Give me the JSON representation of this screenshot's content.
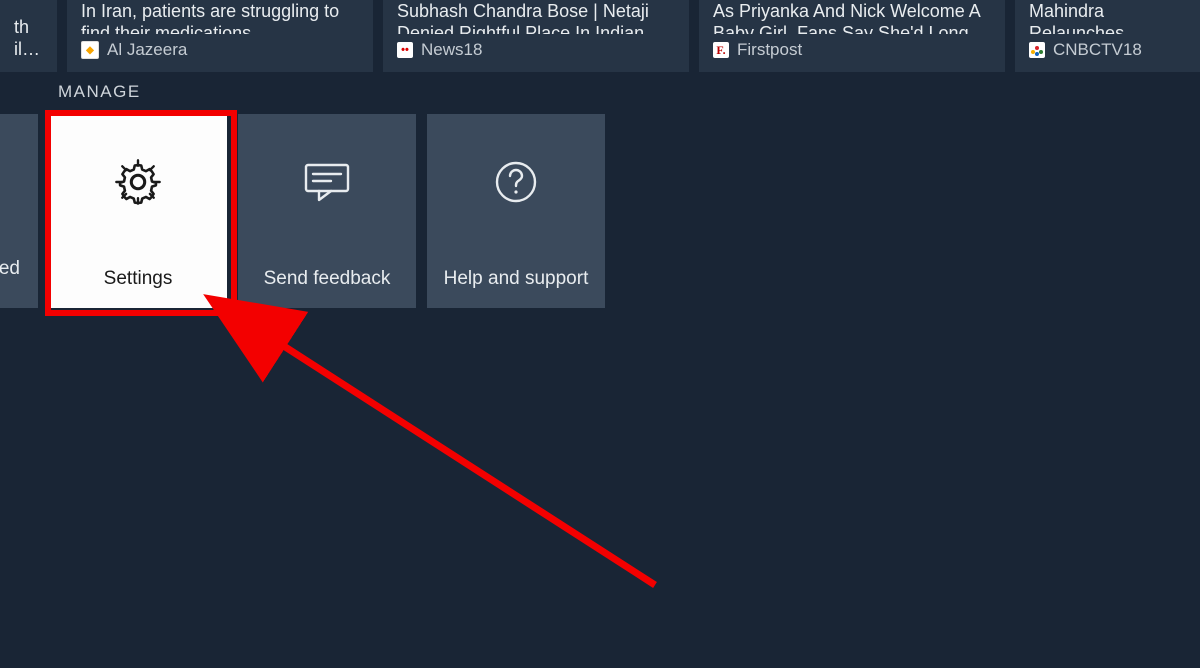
{
  "news": [
    {
      "title_visible": "il…",
      "title_prefix": "th",
      "source": "",
      "src_icon": ""
    },
    {
      "title": "In Iran, patients are struggling to find their medications",
      "source": "Al Jazeera",
      "src_icon": "aj"
    },
    {
      "title": "Subhash Chandra Bose | Netaji Denied Rightful Place In Indian…",
      "source": "News18",
      "src_icon": "n18"
    },
    {
      "title": "As Priyanka And Nick Welcome A Baby Girl, Fans Say She'd Long…",
      "source": "Firstpost",
      "src_icon": "fp"
    },
    {
      "title": "Mahindra Relaunches Roadster: Know The S",
      "source": "CNBCTV18",
      "src_icon": "cnbc"
    }
  ],
  "section_label": "MANAGE",
  "manage": {
    "partial_label": "ed",
    "settings": "Settings",
    "feedback": "Send feedback",
    "help": "Help and support"
  },
  "colors": {
    "highlight": "#f30000",
    "bg": "#192535",
    "tile": "#3b4a5c",
    "tile_selected": "#fdfdfd"
  }
}
